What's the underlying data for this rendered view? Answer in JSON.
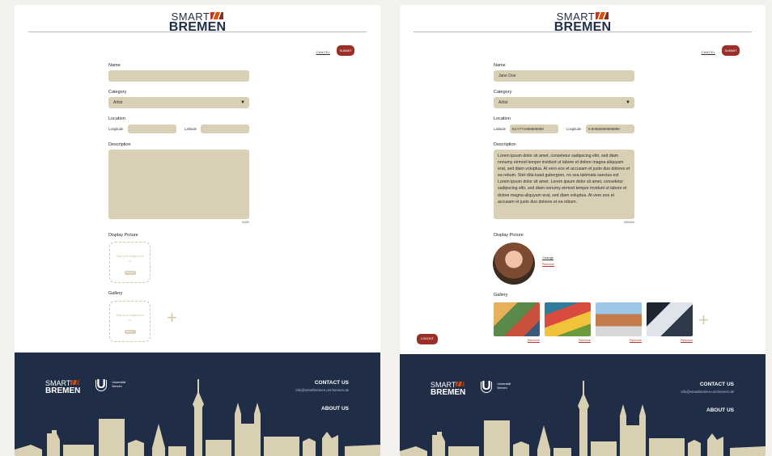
{
  "logo": {
    "line1": "SMART",
    "line2": "BREMEN"
  },
  "actions": {
    "cancel": "CANCEL",
    "submit": "SUBMIT",
    "logout": "LOGOUT"
  },
  "form": {
    "name_label": "Name",
    "category_label": "Category",
    "location_label": "Location",
    "description_label": "Description",
    "display_picture_label": "Display Picture",
    "gallery_label": "Gallery",
    "longitude_label": "Longitude",
    "latitude_label": "Latitude",
    "category_value": "Artist",
    "dropzone_text": "Drop your image here",
    "dropzone_or": "or",
    "dropzone_button": "Browse"
  },
  "left": {
    "counter": "0/400"
  },
  "right": {
    "name_value": "Jane Doe",
    "latitude_value": "53.0771588888889",
    "longitude_value": "8.80685888888889",
    "description_value": "Lorem ipsum dolor sit amet, consetetur sadipscing elitr, sed diam nonumy eirmod tempor invidunt ut labore et dolore magna aliquyam erat, sed diam voluptua. At vero eos et accusam et justo duo dolores et ea rebum. Stet clita kasd gubergren, no sea takimata sanctus est Lorem ipsum dolor sit amet. Lorem ipsum dolor sit amet, consetetur sadipscing elitr, sed diam nonumy eirmod tempor invidunt ut labore et dolore magna aliquyam erat, sed diam voluptua. At vero eos et accusam et justo duo dolores et ea rebum.",
    "counter": "400/400",
    "change": "Change",
    "remove": "Remove"
  },
  "footer": {
    "logo_line1": "SMART",
    "logo_line2": "BREMEN",
    "uni_name_1": "Universität",
    "uni_name_2": "Bremen",
    "contact_heading": "CONTACT US",
    "contact_email": "info@smartbremen.uni-bremen.de",
    "about": "ABOUT US"
  },
  "colors": {
    "navy": "#1f2d47",
    "accent": "#9b2f28",
    "field": "#d8cfb4"
  }
}
